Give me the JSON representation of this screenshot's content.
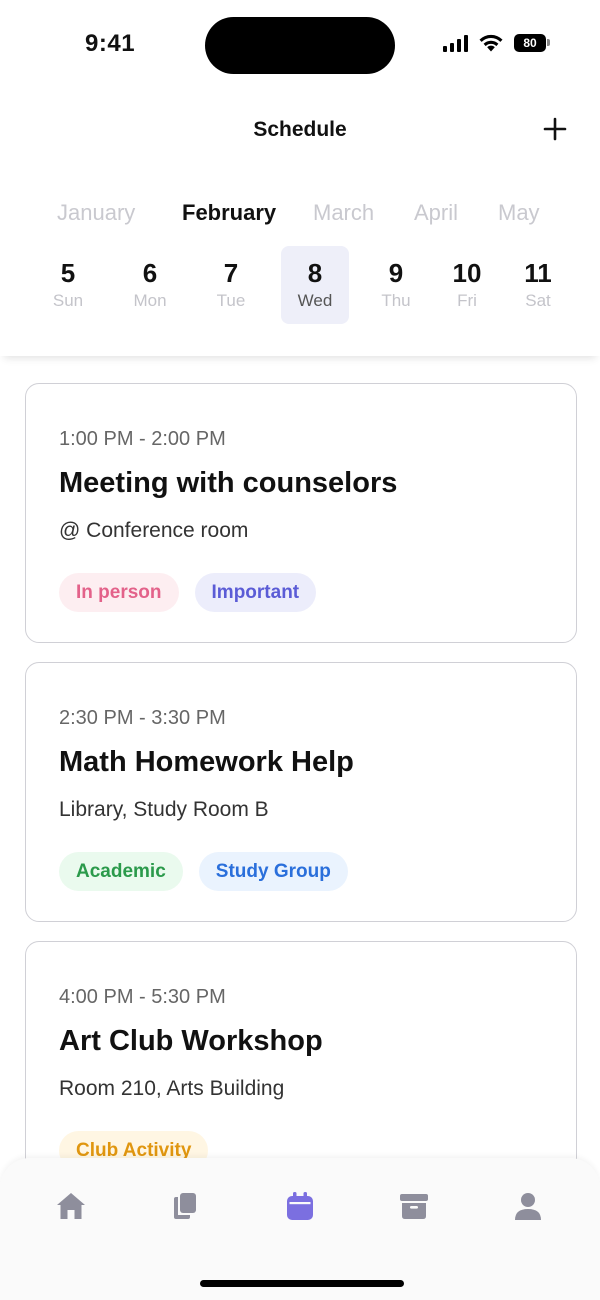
{
  "status_bar": {
    "time": "9:41",
    "battery": "80"
  },
  "header": {
    "title": "Schedule",
    "add_icon": "plus-icon"
  },
  "calendar": {
    "months": [
      "January",
      "February",
      "March",
      "April",
      "May"
    ],
    "selected_month": "February",
    "days": [
      {
        "num": "5",
        "name": "Sun"
      },
      {
        "num": "6",
        "name": "Mon"
      },
      {
        "num": "7",
        "name": "Tue"
      },
      {
        "num": "8",
        "name": "Wed"
      },
      {
        "num": "9",
        "name": "Thu"
      },
      {
        "num": "10",
        "name": "Fri"
      },
      {
        "num": "11",
        "name": "Sat"
      }
    ],
    "selected_day": "8"
  },
  "events": [
    {
      "time": "1:00 PM - 2:00 PM",
      "title": "Meeting with counselors",
      "location": "@ Conference room",
      "tags": [
        {
          "label": "In person",
          "bg": "#fdeef1",
          "color": "#e3628a"
        },
        {
          "label": "Important",
          "bg": "#ecedfb",
          "color": "#5b5cd6"
        }
      ]
    },
    {
      "time": "2:30 PM - 3:30 PM",
      "title": "Math Homework Help",
      "location": "Library, Study Room B",
      "tags": [
        {
          "label": "Academic",
          "bg": "#eafaee",
          "color": "#2b9a4b"
        },
        {
          "label": "Study Group",
          "bg": "#eaf3fe",
          "color": "#2a6fdb"
        }
      ]
    },
    {
      "time": "4:00 PM - 5:30 PM",
      "title": "Art Club Workshop",
      "location": "Room 210, Arts Building",
      "tags": [
        {
          "label": "Club Activity",
          "bg": "#fff6e3",
          "color": "#e0960f"
        }
      ]
    }
  ],
  "tabbar": {
    "items": [
      "home-icon",
      "documents-icon",
      "calendar-icon",
      "archive-icon",
      "profile-icon"
    ],
    "active": "calendar-icon",
    "active_color": "#7b6fe0",
    "inactive_color": "#8e8e9c"
  }
}
